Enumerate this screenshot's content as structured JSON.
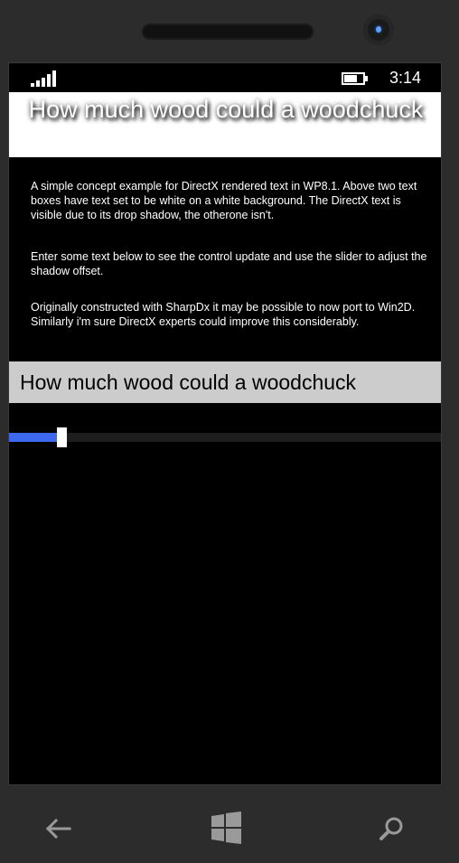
{
  "status": {
    "time": "3:14"
  },
  "header": {
    "shadow_text": "How much wood could a woodchuck"
  },
  "description": {
    "para1": "A simple concept example for DirectX rendered text in WP8.1. Above two text boxes have text set to be white on a white background. The DirectX text is visible due to its drop shadow, the otherone isn't.",
    "para2": "Enter some text below to see the control update and use the slider to adjust the shadow offset.",
    "para3": "Originally constructed with SharpDx it may be possible to now port to Win2D. Similarly i'm sure DirectX experts could improve this considerably."
  },
  "input": {
    "value": "How much wood could a woodchuck"
  },
  "slider": {
    "value_fraction": 0.11,
    "accent": "#3c69f0"
  },
  "icons": {
    "back": "back-arrow-icon",
    "home": "windows-logo-icon",
    "search": "search-icon"
  }
}
